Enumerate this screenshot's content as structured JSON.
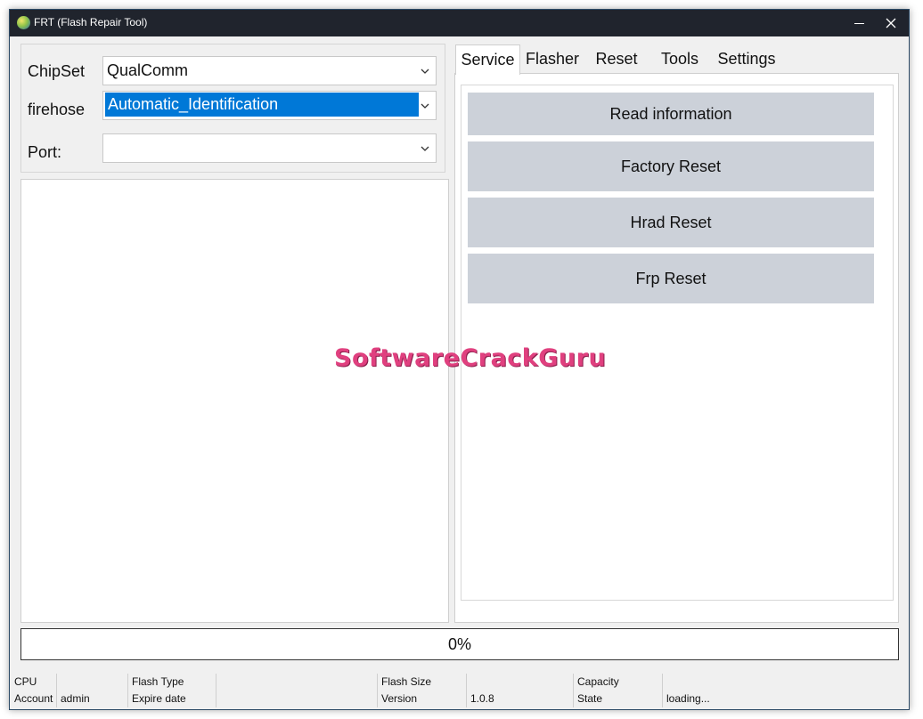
{
  "window": {
    "title": "FRT (Flash Repair Tool)"
  },
  "form": {
    "chipset": {
      "label": "ChipSet",
      "value": "QualComm"
    },
    "firehose": {
      "label": "firehose",
      "value": "Automatic_Identification"
    },
    "port": {
      "label": "Port:",
      "value": ""
    }
  },
  "tabs": [
    {
      "label": "Service"
    },
    {
      "label": "Flasher"
    },
    {
      "label": "Reset"
    },
    {
      "label": "Tools"
    },
    {
      "label": "Settings"
    }
  ],
  "service_buttons": [
    {
      "label": "Read information"
    },
    {
      "label": "Factory Reset"
    },
    {
      "label": "Hrad Reset"
    },
    {
      "label": "Frp Reset"
    }
  ],
  "watermark": "SoftwareCrackGuru",
  "progress": {
    "text": "0%",
    "value": 0
  },
  "status": {
    "cpu_label": "CPU",
    "cpu_value": "",
    "flash_type_label": "Flash Type",
    "flash_type_value": "",
    "flash_size_label": "Flash Size",
    "flash_size_value": "",
    "capacity_label": "Capacity",
    "capacity_value": "",
    "account_label": "Account",
    "account_value": "admin",
    "expire_label": "Expire date",
    "expire_value": "",
    "version_label": "Version",
    "version_value": "1.0.8",
    "state_label": "State",
    "state_value": "loading..."
  }
}
